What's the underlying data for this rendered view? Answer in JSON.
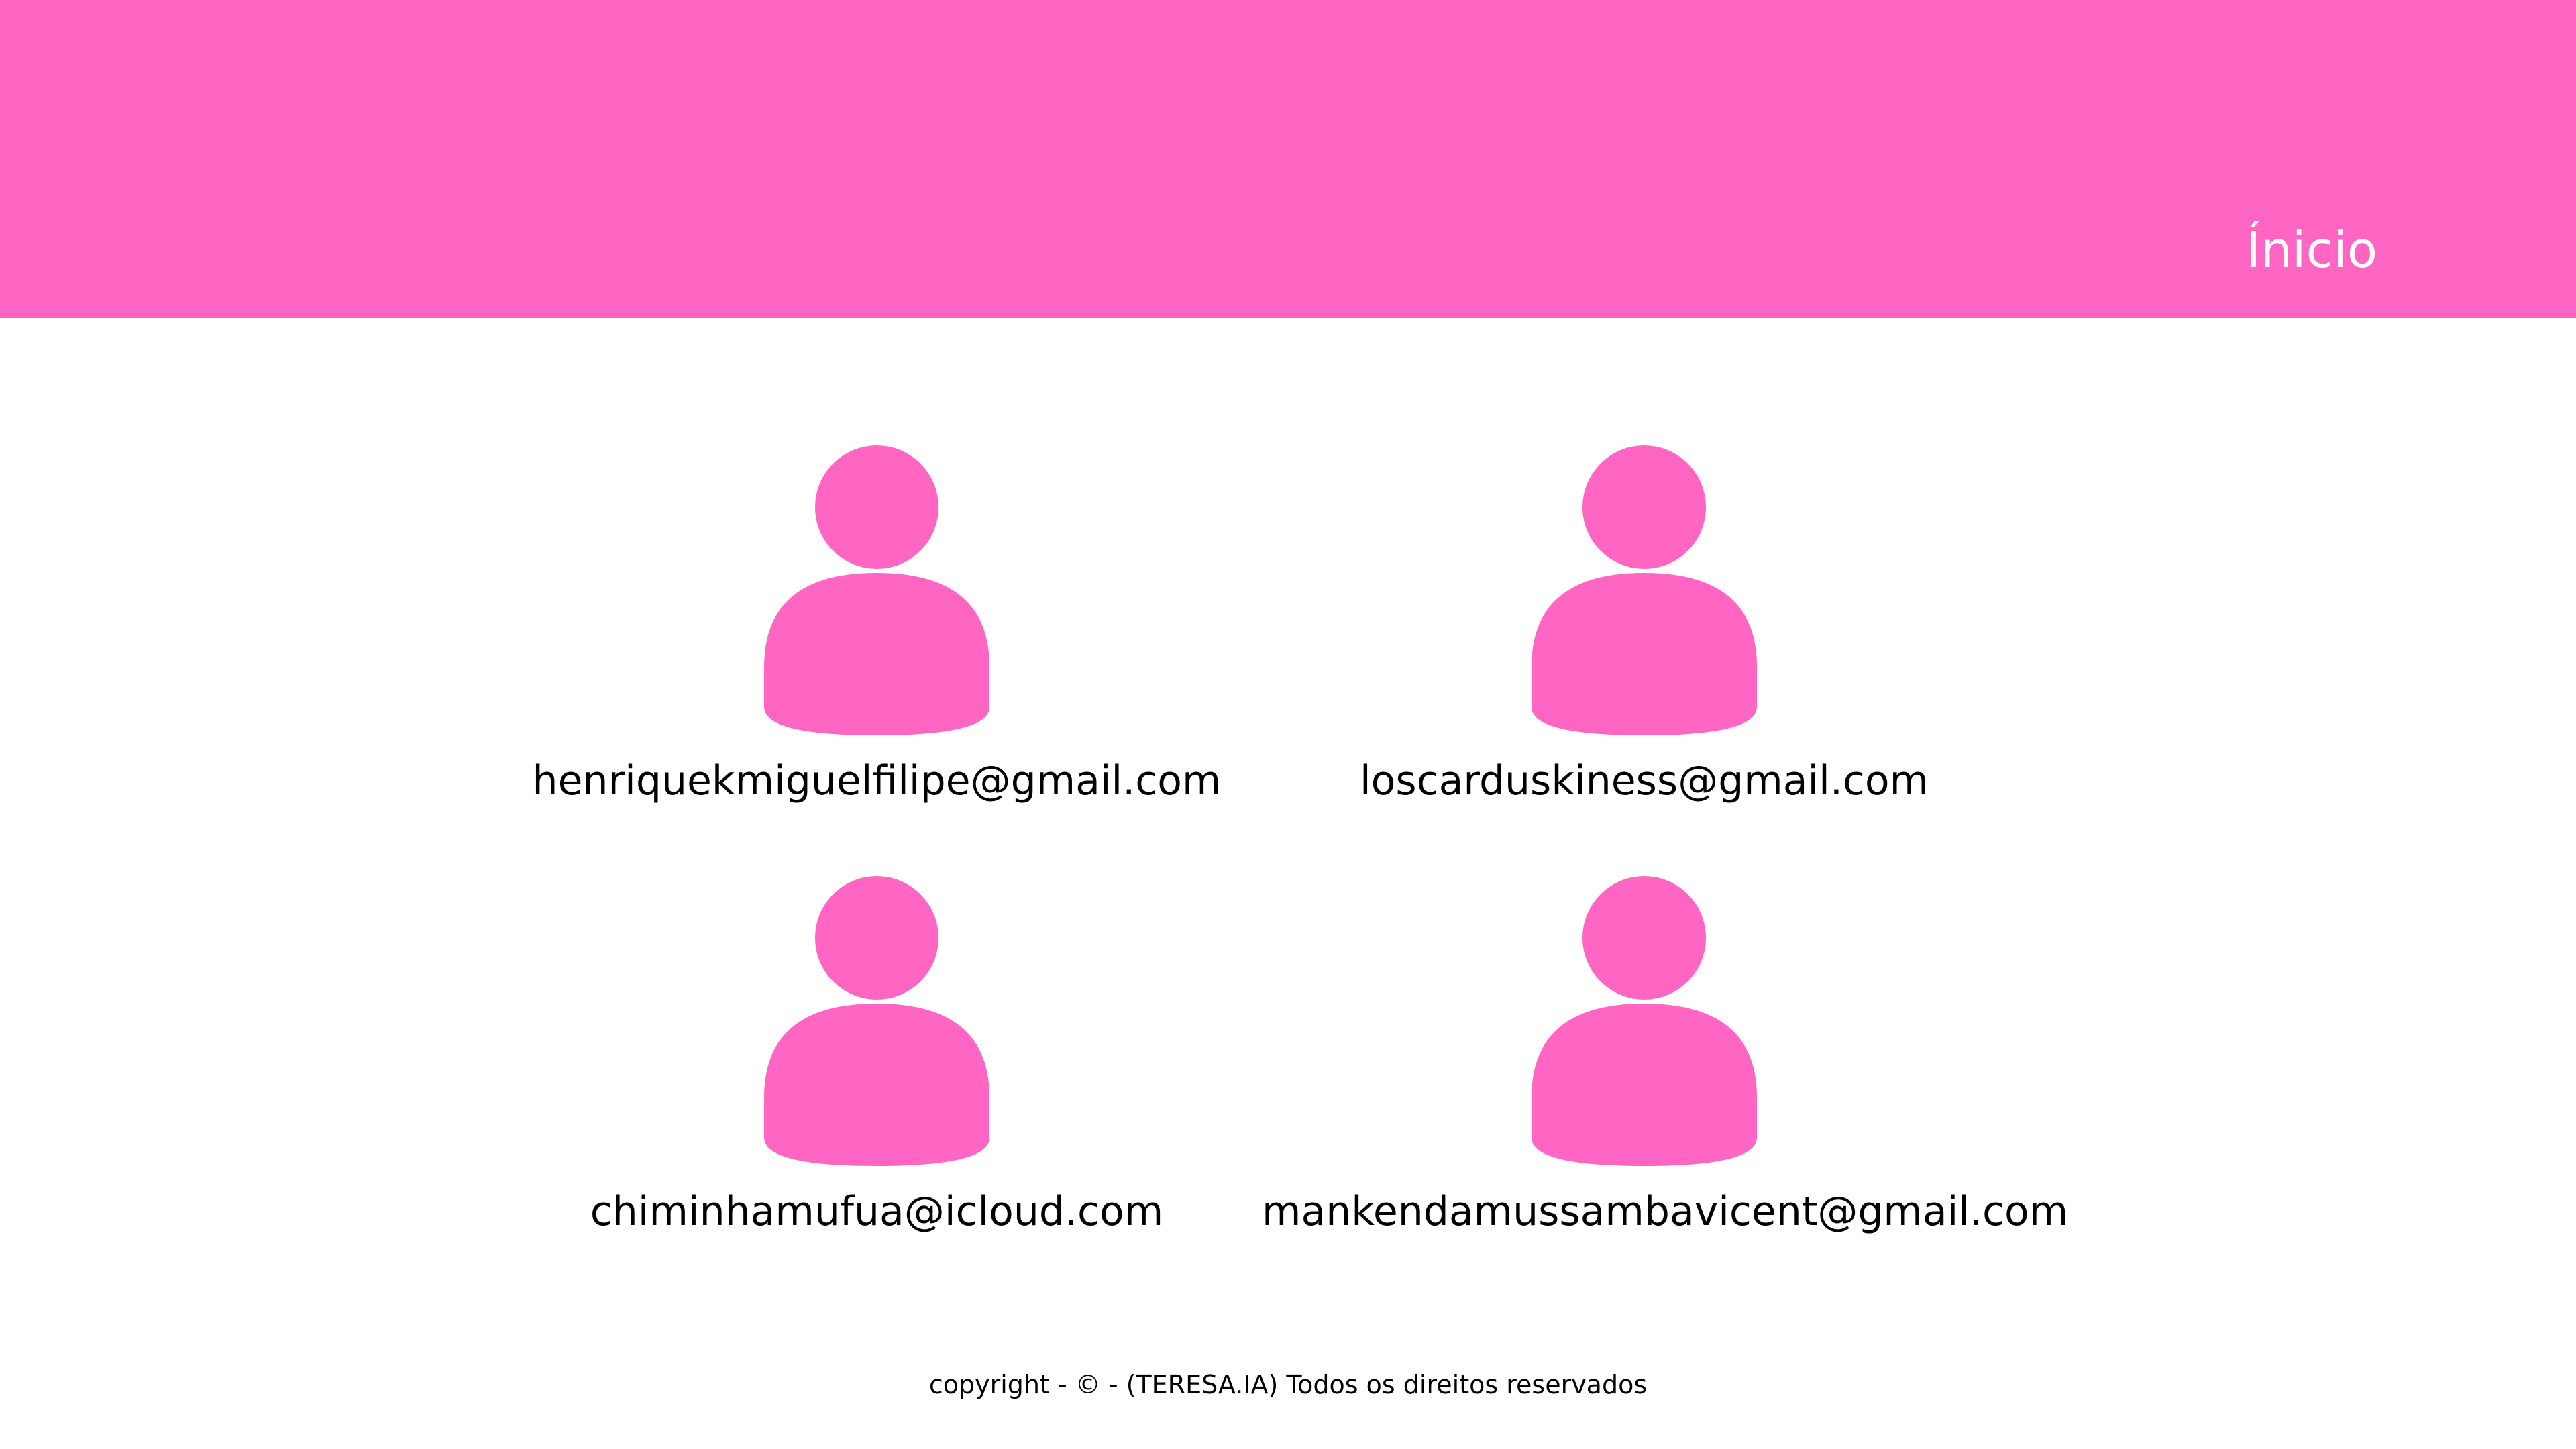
{
  "header": {
    "background_color": "#ff66c4",
    "nav_link_label": "Ínicio"
  },
  "users": [
    {
      "email": "henriquekmiguelfilipe@gmail.com",
      "icon": "user-icon"
    },
    {
      "email": "loscarduskiness@gmail.com",
      "icon": "user-icon"
    },
    {
      "email": "chiminhamufua@icloud.com",
      "icon": "user-icon"
    },
    {
      "email": "mankendamussambavicent@gmail.com",
      "icon": "user-icon"
    }
  ],
  "avatar_color": "#ff66c4",
  "footer": {
    "copyright": "copyright - © - (TERESA.IA) Todos os direitos reservados"
  }
}
